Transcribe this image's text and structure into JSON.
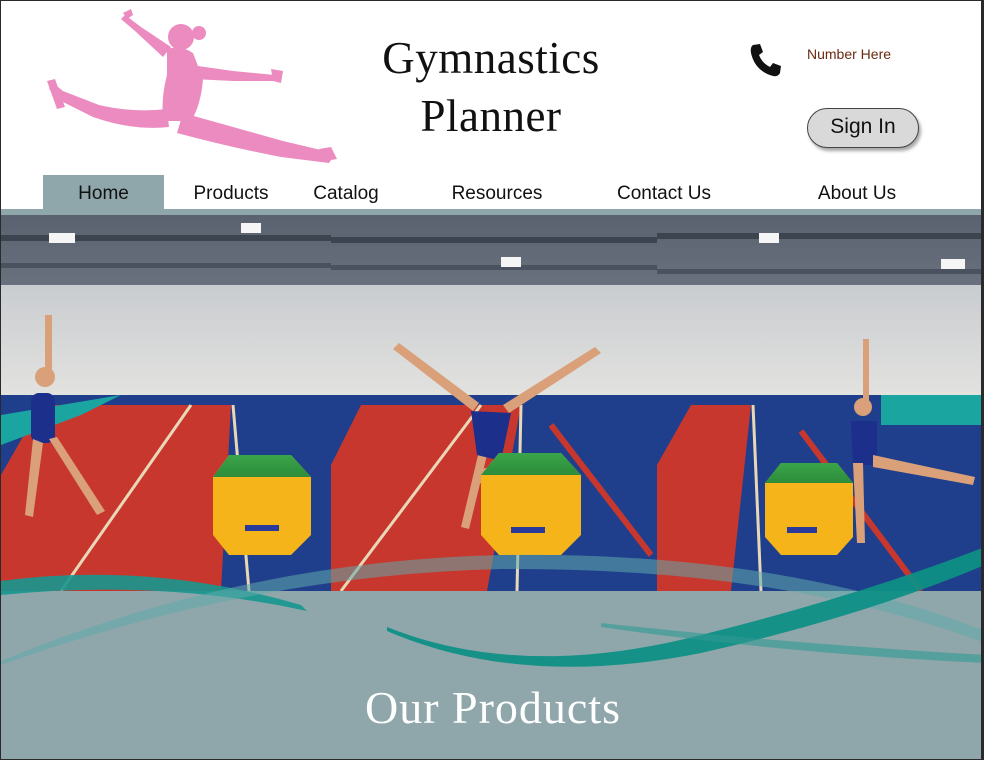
{
  "header": {
    "title_line1": "Gymnastics",
    "title_line2": "Planner",
    "phone_number": "Number Here",
    "sign_in_label": "Sign In"
  },
  "nav": {
    "items": [
      {
        "label": "Home",
        "active": true
      },
      {
        "label": "Products",
        "active": false
      },
      {
        "label": "Catalog",
        "active": false
      },
      {
        "label": "Resources",
        "active": false
      },
      {
        "label": "Contact Us",
        "active": false
      },
      {
        "label": "About Us",
        "active": false
      }
    ]
  },
  "main": {
    "section_title": "Our Products"
  },
  "colors": {
    "accent_bar": "#8fa7ab",
    "logo_pink": "#ec8bc0",
    "wave_teal": "#0f8f86",
    "floor_red": "#c8372d",
    "floor_blue": "#1f3f8c"
  },
  "icons": {
    "logo": "gymnast-leap-silhouette",
    "phone": "phone-icon"
  }
}
